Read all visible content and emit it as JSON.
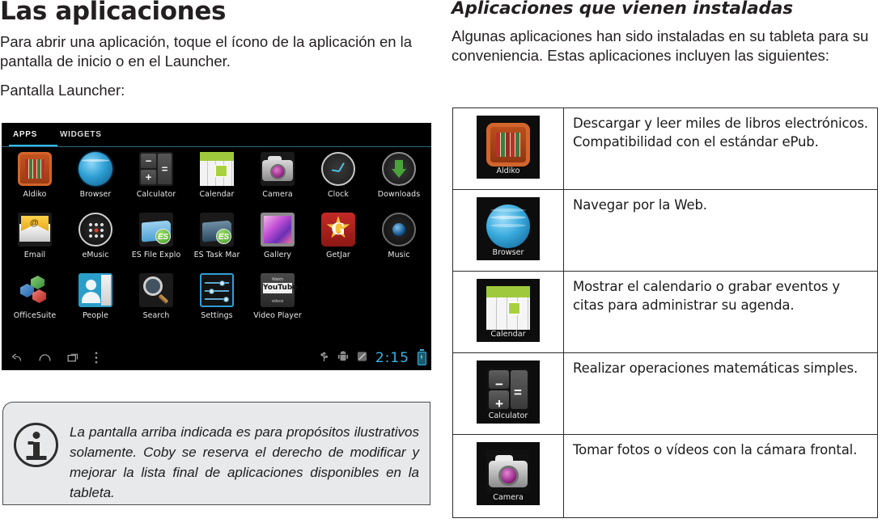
{
  "left": {
    "heading": "Las aplicaciones",
    "paragraph1": "Para abrir una aplicación, toque el ícono de la aplicación en la pantalla de inicio o en el Launcher.",
    "paragraph2": "Pantalla Launcher:",
    "launcher": {
      "tabs": [
        {
          "label": "APPS",
          "active": true
        },
        {
          "label": "WIDGETS",
          "active": false
        }
      ],
      "accent_color": "#33b5e5",
      "background_color": "#000000",
      "apps": [
        {
          "label": "Aldiko",
          "icon": "aldiko-icon"
        },
        {
          "label": "Browser",
          "icon": "browser-icon"
        },
        {
          "label": "Calculator",
          "icon": "calculator-icon"
        },
        {
          "label": "Calendar",
          "icon": "calendar-icon"
        },
        {
          "label": "Camera",
          "icon": "camera-icon"
        },
        {
          "label": "Clock",
          "icon": "clock-icon"
        },
        {
          "label": "Downloads",
          "icon": "downloads-icon"
        },
        {
          "label": "Email",
          "icon": "email-icon"
        },
        {
          "label": "eMusic",
          "icon": "emusic-icon"
        },
        {
          "label": "ES File Explo",
          "icon": "es-file-explorer-icon"
        },
        {
          "label": "ES Task Mar",
          "icon": "es-task-manager-icon"
        },
        {
          "label": "Gallery",
          "icon": "gallery-icon"
        },
        {
          "label": "GetJar",
          "icon": "getjar-icon"
        },
        {
          "label": "Music",
          "icon": "music-icon"
        },
        {
          "label": "OfficeSuite",
          "icon": "officesuite-icon"
        },
        {
          "label": "People",
          "icon": "people-icon"
        },
        {
          "label": "Search",
          "icon": "search-icon"
        },
        {
          "label": "Settings",
          "icon": "settings-icon"
        },
        {
          "label": "Video Player",
          "icon": "video-player-icon"
        }
      ],
      "statusbar": {
        "nav": [
          "back-icon",
          "home-icon",
          "recents-icon",
          "menu-icon"
        ],
        "indicators": [
          "usb-icon",
          "android-debug-icon",
          "sd-card-icon"
        ],
        "clock": "2:15",
        "battery": "battery-charging-icon"
      }
    },
    "note": {
      "icon": "info-icon",
      "text": "La pantalla arriba indicada es para propósitos ilustrativos solamente. Coby se reserva el derecho de modificar y mejorar la lista final de aplicaciones disponibles en la tableta."
    }
  },
  "right": {
    "heading": "Aplicaciones que vienen instaladas",
    "paragraph": "Algunas aplicaciones han sido instaladas en su tableta para su conveniencia. Estas aplicaciones incluyen las siguientes:",
    "table": {
      "rows": [
        {
          "app": "Aldiko",
          "icon": "aldiko-icon",
          "description": "Descargar y leer miles de libros electrónicos. Compatibilidad con el estándar ePub."
        },
        {
          "app": "Browser",
          "icon": "browser-icon",
          "description": "Navegar por la Web."
        },
        {
          "app": "Calendar",
          "icon": "calendar-icon",
          "description": "Mostrar el calendario o grabar eventos y citas para administrar su agenda."
        },
        {
          "app": "Calculator",
          "icon": "calculator-icon",
          "description": "Realizar operaciones matemáticas simples."
        },
        {
          "app": "Camera",
          "icon": "camera-icon",
          "description": "Tomar fotos o vídeos con la cámara frontal."
        }
      ]
    }
  }
}
